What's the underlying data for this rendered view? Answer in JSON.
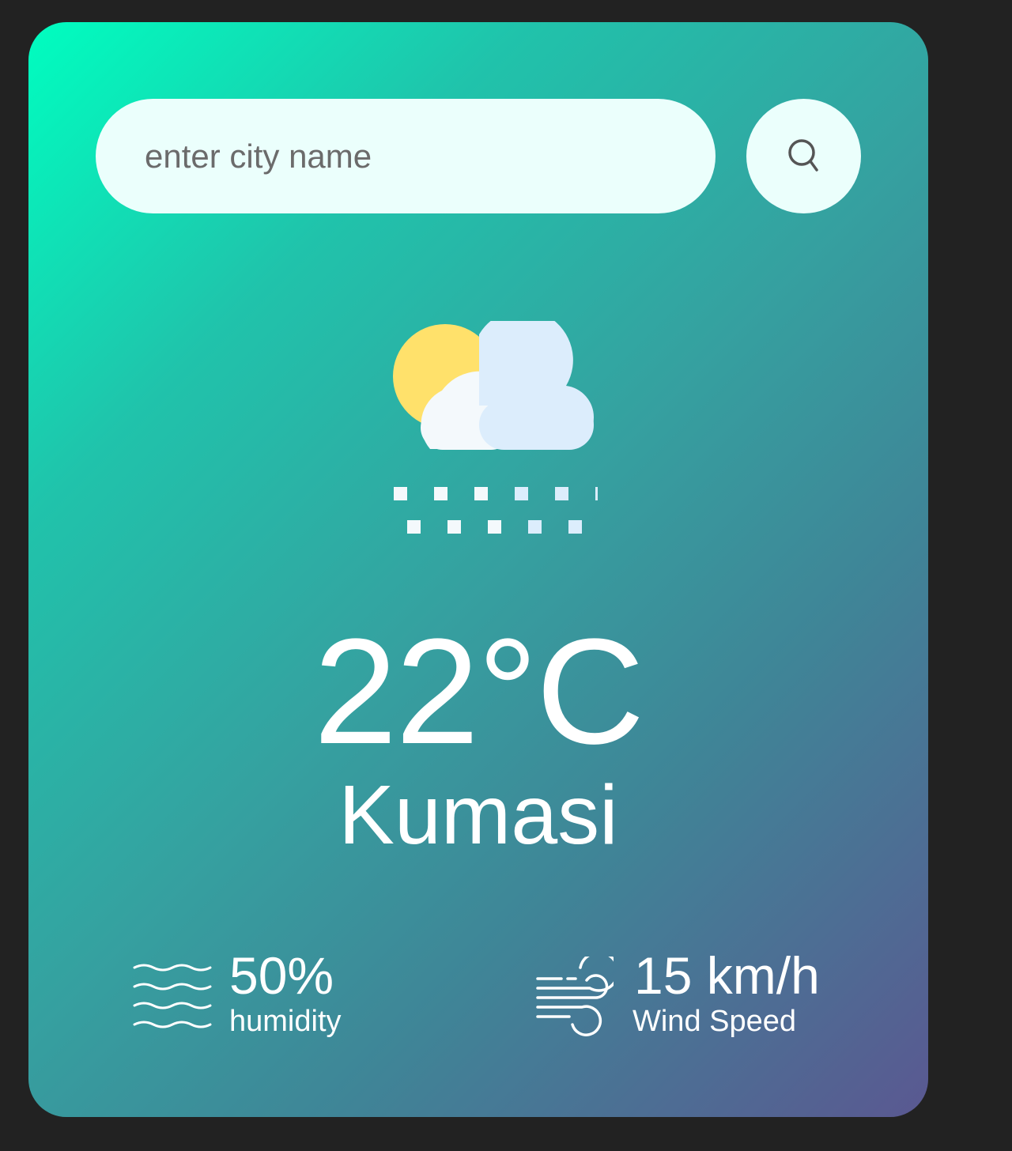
{
  "search": {
    "placeholder": "enter city name",
    "value": "",
    "button_icon": "search-icon"
  },
  "weather": {
    "icon": "snow-cloud-sun-icon",
    "temperature": "22°C",
    "city": "Kumasi"
  },
  "humidity": {
    "icon": "humidity-waves-icon",
    "value": "50%",
    "label": "humidity"
  },
  "wind": {
    "icon": "wind-icon",
    "value": "15 km/h",
    "label": "Wind Speed"
  },
  "colors": {
    "background": "#222222",
    "gradient_start": "#00fec0",
    "gradient_end": "#5a5891",
    "input_background": "#ebfffc",
    "text": "#ffffff"
  }
}
